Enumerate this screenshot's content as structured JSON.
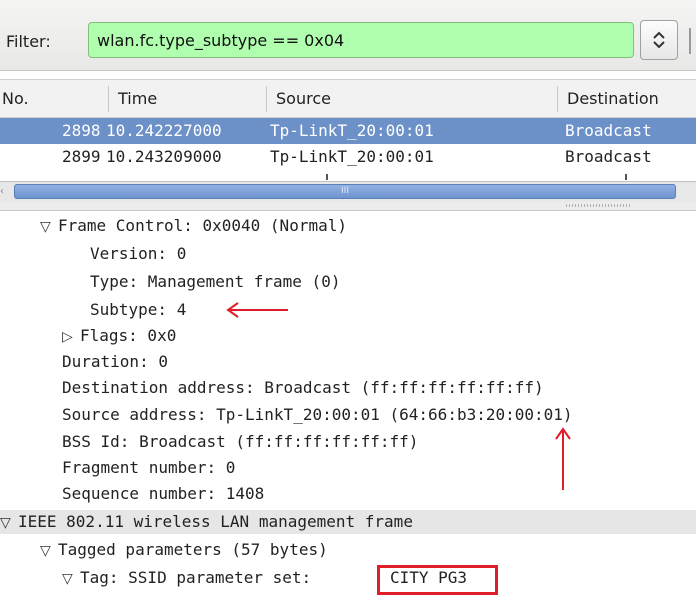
{
  "filter": {
    "label": "Filter:",
    "value": "wlan.fc.type_subtype == 0x04",
    "dropdown_icon": "⌃⌄"
  },
  "packet_list": {
    "columns": [
      "No.",
      "Time",
      "Source",
      "Destination"
    ],
    "rows": [
      {
        "no": "2898",
        "time": "10.242227000",
        "source": "Tp-LinkT_20:00:01",
        "destination": "Broadcast",
        "selected": true
      },
      {
        "no": "2899",
        "time": "10.243209000",
        "source": "Tp-LinkT_20:00:01",
        "destination": "Broadcast",
        "selected": false
      }
    ]
  },
  "scrollbar": {
    "thumb_glyph": "III",
    "left_glyph": "‹"
  },
  "details": {
    "lines": [
      "Frame Control: 0x0040 (Normal)",
      "Version: 0",
      "Type: Management frame (0)",
      "Subtype: 4",
      "Flags: 0x0",
      "Duration: 0",
      "Destination address: Broadcast (ff:ff:ff:ff:ff:ff)",
      "Source address: Tp-LinkT_20:00:01 (64:66:b3:20:00:01)",
      "BSS Id: Broadcast (ff:ff:ff:ff:ff:ff)",
      "Fragment number: 0",
      "Sequence number: 1408",
      "IEEE 802.11 wireless LAN management frame",
      "Tagged parameters (57 bytes)",
      "Tag: SSID parameter set:",
      "CITY PG3"
    ]
  },
  "colors": {
    "filter_valid": "#afffaf",
    "selected_row": "#6c90c8",
    "annotation": "#e01e2a"
  },
  "icons": {
    "expanded": "▽",
    "collapsed": "▷"
  }
}
